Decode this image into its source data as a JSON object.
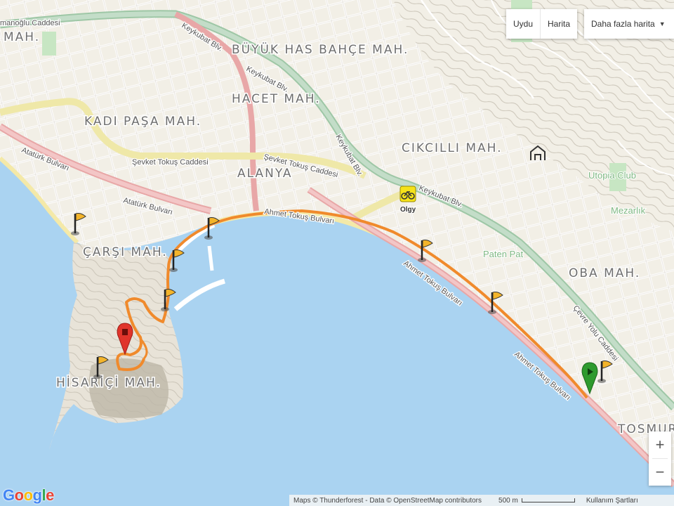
{
  "map_type": {
    "satellite_label": "Uydu",
    "map_label": "Harita",
    "more_maps_label": "Daha fazla harita"
  },
  "zoom": {
    "in_label": "+",
    "out_label": "−"
  },
  "logo": {
    "g": "G",
    "o1": "o",
    "o2": "o",
    "g2": "g",
    "l": "l",
    "e": "e"
  },
  "footer": {
    "attribution": "Maps © Thunderforest - Data © OpenStreetMap contributors",
    "scale": "500 m",
    "terms": "Kullanım Şartları"
  },
  "districts": [
    "BÜYÜK HAS BAHÇE MAH.",
    "HACET MAH.",
    "KADI PAŞA MAH.",
    "CIKCILLI MAH.",
    "ALANYA",
    "ÇARŞI MAH.",
    "OBA MAH.",
    "HİSARİÇİ MAH.",
    "TOSMUR",
    "MAH."
  ],
  "streets": [
    "manoğlu Caddesi",
    "Keykubat Blv.",
    "Keykubat Blv.",
    "Şevket Tokuş Caddesi",
    "Şevket Tokuş Caddesi",
    "Atatürk Bulvarı",
    "Atatürk Bulvarı",
    "Keykubat Blv.",
    "Keykubat Blv.",
    "Ahmet Tokuş Bulvarı",
    "Ahmet Tokuş Bulvarı",
    "Ahmet Tokuş Bulvarı",
    "Çevre Yolu Caddesi"
  ],
  "pois": [
    "Utopia Club",
    "Mezarlık",
    "Paten Pat"
  ],
  "bike_station": "Olgy",
  "colors": {
    "sea": "#aad3f1",
    "land": "#f2efe6",
    "route": "#f08a2c",
    "main_road": "#9ec7a6",
    "yellow_road": "#efe8a8",
    "red_road": "#e8a7a7",
    "start_marker": "#2e9a2e",
    "end_marker": "#e0342b",
    "flag": "#f3b42a"
  },
  "markers": {
    "flag_icon": "flag-icon",
    "start_icon": "start-pin-icon",
    "end_icon": "end-pin-icon",
    "bike_icon": "bicycle-icon",
    "castle_icon": "castle-icon"
  }
}
